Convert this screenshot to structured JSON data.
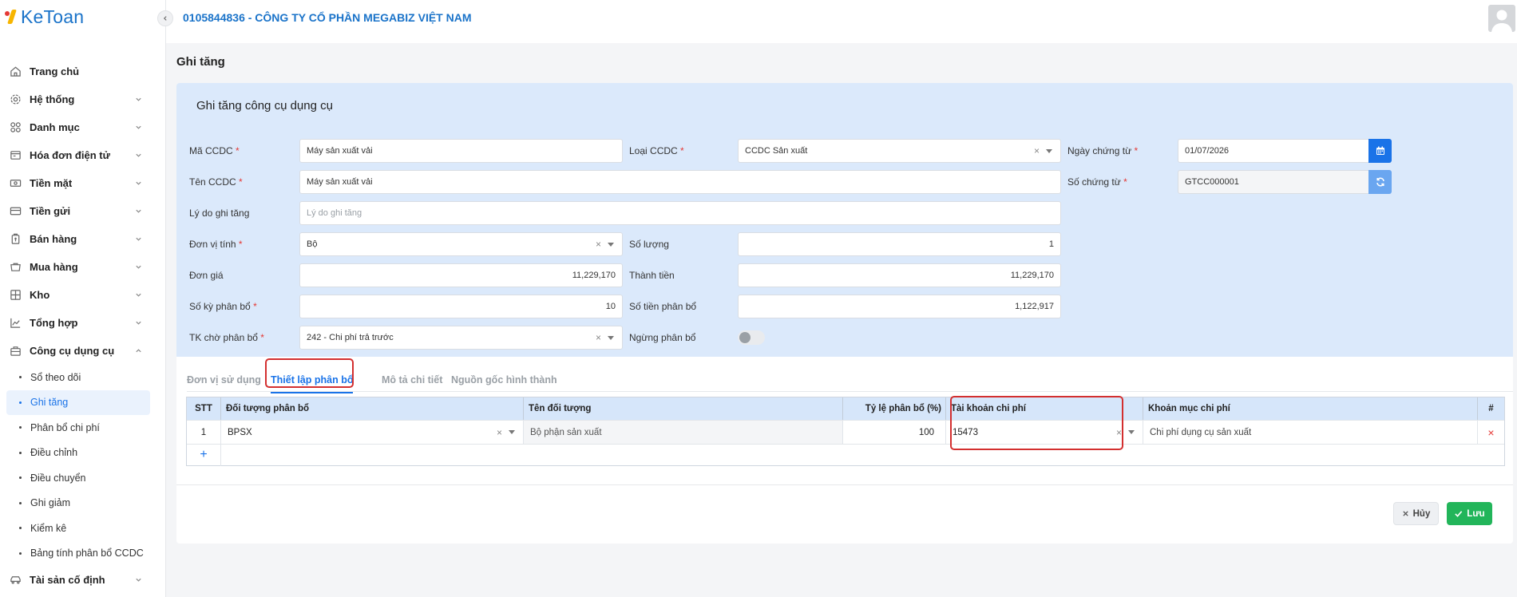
{
  "app": {
    "logo_text": "KeToan",
    "company": "0105844836 - CÔNG TY CỔ PHẦN MEGABIZ VIỆT NAM"
  },
  "sidebar": {
    "items": [
      {
        "label": "Trang chủ",
        "icon": "home-icon"
      },
      {
        "label": "Hệ thống",
        "icon": "settings-icon"
      },
      {
        "label": "Danh mục",
        "icon": "grid-icon"
      },
      {
        "label": "Hóa đơn điện tử",
        "icon": "invoice-icon"
      },
      {
        "label": "Tiền mặt",
        "icon": "cash-icon"
      },
      {
        "label": "Tiền gửi",
        "icon": "bank-card-icon"
      },
      {
        "label": "Bán hàng",
        "icon": "sales-icon"
      },
      {
        "label": "Mua hàng",
        "icon": "purchase-icon"
      },
      {
        "label": "Kho",
        "icon": "warehouse-icon"
      },
      {
        "label": "Tổng hợp",
        "icon": "chart-line-icon"
      },
      {
        "label": "Công cụ dụng cụ",
        "icon": "tools-icon"
      }
    ],
    "subitems": [
      "Sổ theo dõi",
      "Ghi tăng",
      "Phân bổ chi phí",
      "Điều chỉnh",
      "Điều chuyển",
      "Ghi giảm",
      "Kiểm kê",
      "Bảng tính phân bổ CCDC"
    ],
    "last_item": {
      "label": "Tài sản cố định",
      "icon": "car-icon"
    }
  },
  "page": {
    "title": "Ghi tăng",
    "card_title": "Ghi tăng công cụ dụng cụ"
  },
  "form": {
    "ma_ccdc": {
      "label": "Mã CCDC",
      "value": "Máy sản xuất vải"
    },
    "loai_ccdc": {
      "label": "Loại CCDC",
      "value": "CCDC Sản xuất"
    },
    "ngay_chung_tu": {
      "label": "Ngày chứng từ",
      "value": "01/07/2026"
    },
    "ten_ccdc": {
      "label": "Tên CCDC",
      "value": "Máy sản xuất vải"
    },
    "so_chung_tu": {
      "label": "Số chứng từ",
      "value": "GTCC000001"
    },
    "ly_do": {
      "label": "Lý do ghi tăng",
      "placeholder": "Lý do ghi tăng"
    },
    "don_vi_tinh": {
      "label": "Đơn vị tính",
      "value": "Bộ"
    },
    "so_luong": {
      "label": "Số lượng",
      "value": "1"
    },
    "don_gia": {
      "label": "Đơn giá",
      "value": "11,229,170"
    },
    "thanh_tien": {
      "label": "Thành tiền",
      "value": "11,229,170"
    },
    "so_ky": {
      "label": "Số kỳ phân bổ",
      "value": "10"
    },
    "so_tien_pb": {
      "label": "Số tiền phân bổ",
      "value": "1,122,917"
    },
    "tk_cho_pb": {
      "label": "TK chờ phân bổ",
      "value": "242 - Chi phí trả trước"
    },
    "ngung_pb": {
      "label": "Ngừng phân bổ",
      "checked": false
    },
    "required_mark": "*",
    "clear_symbol": "×"
  },
  "tabs": [
    "Đơn vị sử dụng",
    "Thiết lập phân bổ",
    "Mô tả chi tiết",
    "Nguồn gốc hình thành"
  ],
  "table": {
    "headers": [
      "STT",
      "Đối tượng phân bổ",
      "Tên đối tượng",
      "Tỷ lệ phân bổ (%)",
      "Tài khoản chi phí",
      "Khoản mục chi phí",
      "#"
    ],
    "rows": [
      {
        "stt": "1",
        "doi_tuong": "BPSX",
        "ten": "Bộ phận sản xuất",
        "ty_le": "100",
        "tai_khoan": "15473",
        "khoan_muc": "Chi phí dụng cụ sản xuất"
      }
    ],
    "add_symbol": "+",
    "delete_symbol": "×"
  },
  "buttons": {
    "cancel": "Hủy",
    "save": "Lưu"
  },
  "colors": {
    "primary": "#1a73e8",
    "save": "#22b55a",
    "required": "#e53935",
    "highlight": "#d32f2f"
  }
}
